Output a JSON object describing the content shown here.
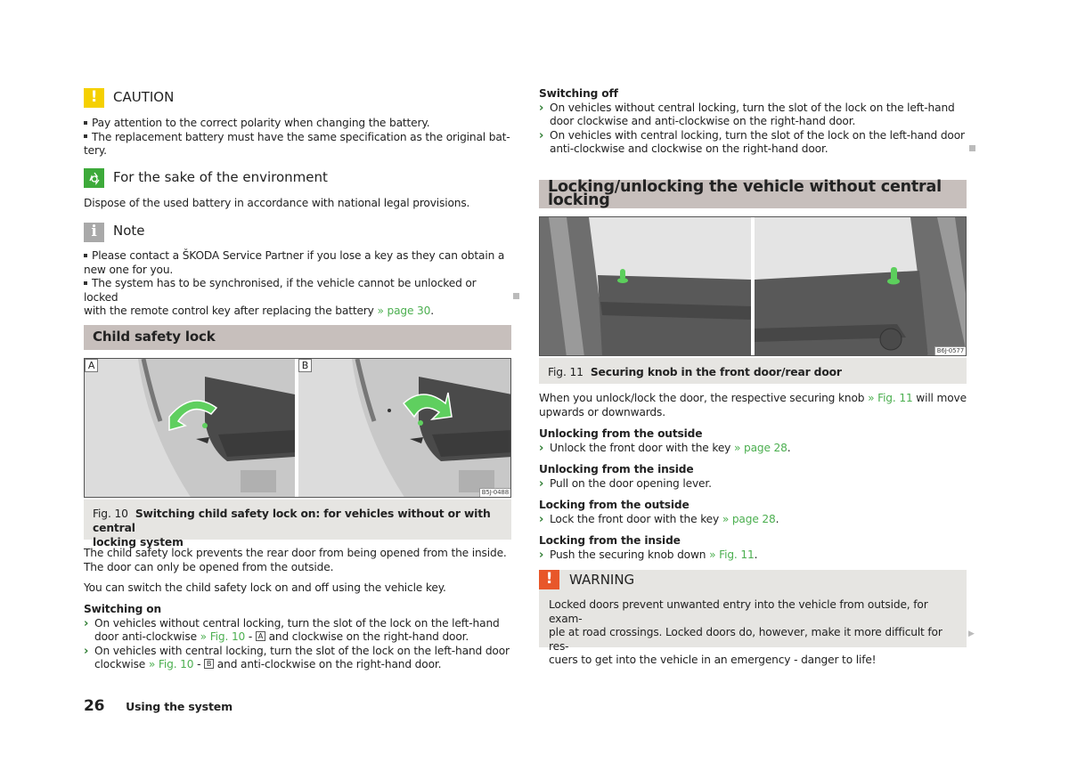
{
  "left": {
    "caution": {
      "icon": "exclamation-icon",
      "title": "CAUTION",
      "color": "#f5d000",
      "items": [
        "Pay attention to the correct polarity when changing the battery.",
        "The replacement battery must have the same specification as the original bat-",
        "tery."
      ]
    },
    "environment": {
      "icon": "recycle-icon",
      "title": "For the sake of the environment",
      "color": "#3daa3a",
      "text": "Dispose of the used battery in accordance with national legal provisions."
    },
    "note": {
      "icon": "info-icon",
      "title": "Note",
      "color": "#a9a9a9",
      "item1_line1": "Please contact a ŠKODA Service Partner if you lose a key as they can obtain a",
      "item1_line2": "new one for you.",
      "item2_line1": "The system has to be synchronised, if the vehicle cannot be unlocked or locked",
      "item2_line2_pre": "with the remote control key after replacing the battery ",
      "item2_link": "» page 30",
      "item2_post": "."
    },
    "section_title": "Child safety lock",
    "figure": {
      "label_a": "A",
      "label_b": "B",
      "code": "B5J-0488",
      "number": "Fig. 10",
      "caption_line1": "Switching child safety lock on: for vehicles without or with central",
      "caption_line2": "locking system"
    },
    "para1_line1": "The child safety lock prevents the rear door from being opened from the inside.",
    "para1_line2": "The door can only be opened from the outside.",
    "para2": "You can switch the child safety lock on and off using the vehicle key.",
    "switching_on": {
      "heading": "Switching on",
      "step1_line1": "On vehicles without central locking, turn the slot of the lock on the left-hand",
      "step1_line2_pre": "door anti-clockwise ",
      "step1_link": "» Fig. 10",
      "step1_dash": " - ",
      "step1_key": "A",
      "step1_post": " and clockwise on the right-hand door.",
      "step2_line1": "On vehicles with central locking, turn the slot of the lock on the left-hand door",
      "step2_line2_pre": "clockwise ",
      "step2_link": "» Fig. 10",
      "step2_dash": " - ",
      "step2_key": "B",
      "step2_post": " and anti-clockwise on the right-hand door."
    }
  },
  "right": {
    "switching_off": {
      "heading": "Switching off",
      "step1_line1": "On vehicles without central locking, turn the slot of the lock on the left-hand",
      "step1_line2": "door clockwise and anti-clockwise on the right-hand door.",
      "step2_line1": "On vehicles with central locking, turn the slot of the lock on the left-hand door",
      "step2_line2": "anti-clockwise and clockwise on the right-hand door."
    },
    "section_title": "Locking/unlocking the vehicle without central locking",
    "figure": {
      "code": "B6J-0577",
      "number": "Fig. 11",
      "caption": "Securing knob in the front door/rear door"
    },
    "intro_pre": "When you unlock/lock the door, the respective securing knob ",
    "intro_link": "» Fig. 11",
    "intro_post": " will move",
    "intro_line2": "upwards or downwards.",
    "blocks": [
      {
        "heading": "Unlocking from the outside",
        "step": "Unlock the front door with the key ",
        "link": "» page 28",
        "post": "."
      },
      {
        "heading": "Unlocking from the inside",
        "step": "Pull on the door opening lever.",
        "link": "",
        "post": ""
      },
      {
        "heading": "Locking from the outside",
        "step": "Lock the front door with the key ",
        "link": "» page 28",
        "post": "."
      },
      {
        "heading": "Locking from the inside",
        "step": "Push the securing knob down ",
        "link": "» Fig. 11",
        "post": "."
      }
    ],
    "warning": {
      "icon": "exclamation-icon",
      "title": "WARNING",
      "color": "#e8572a",
      "line1": "Locked doors prevent unwanted entry into the vehicle from outside, for exam-",
      "line2": "ple at road crossings. Locked doors do, however, make it more difficult for res-",
      "line3": "cuers to get into the vehicle in an emergency - danger to life!"
    }
  },
  "footer": {
    "page_number": "26",
    "chapter": "Using the system"
  },
  "colors": {
    "link": "#4caf50",
    "section_bar": "#c7bfbc",
    "caption_bg": "#e6e5e2"
  }
}
